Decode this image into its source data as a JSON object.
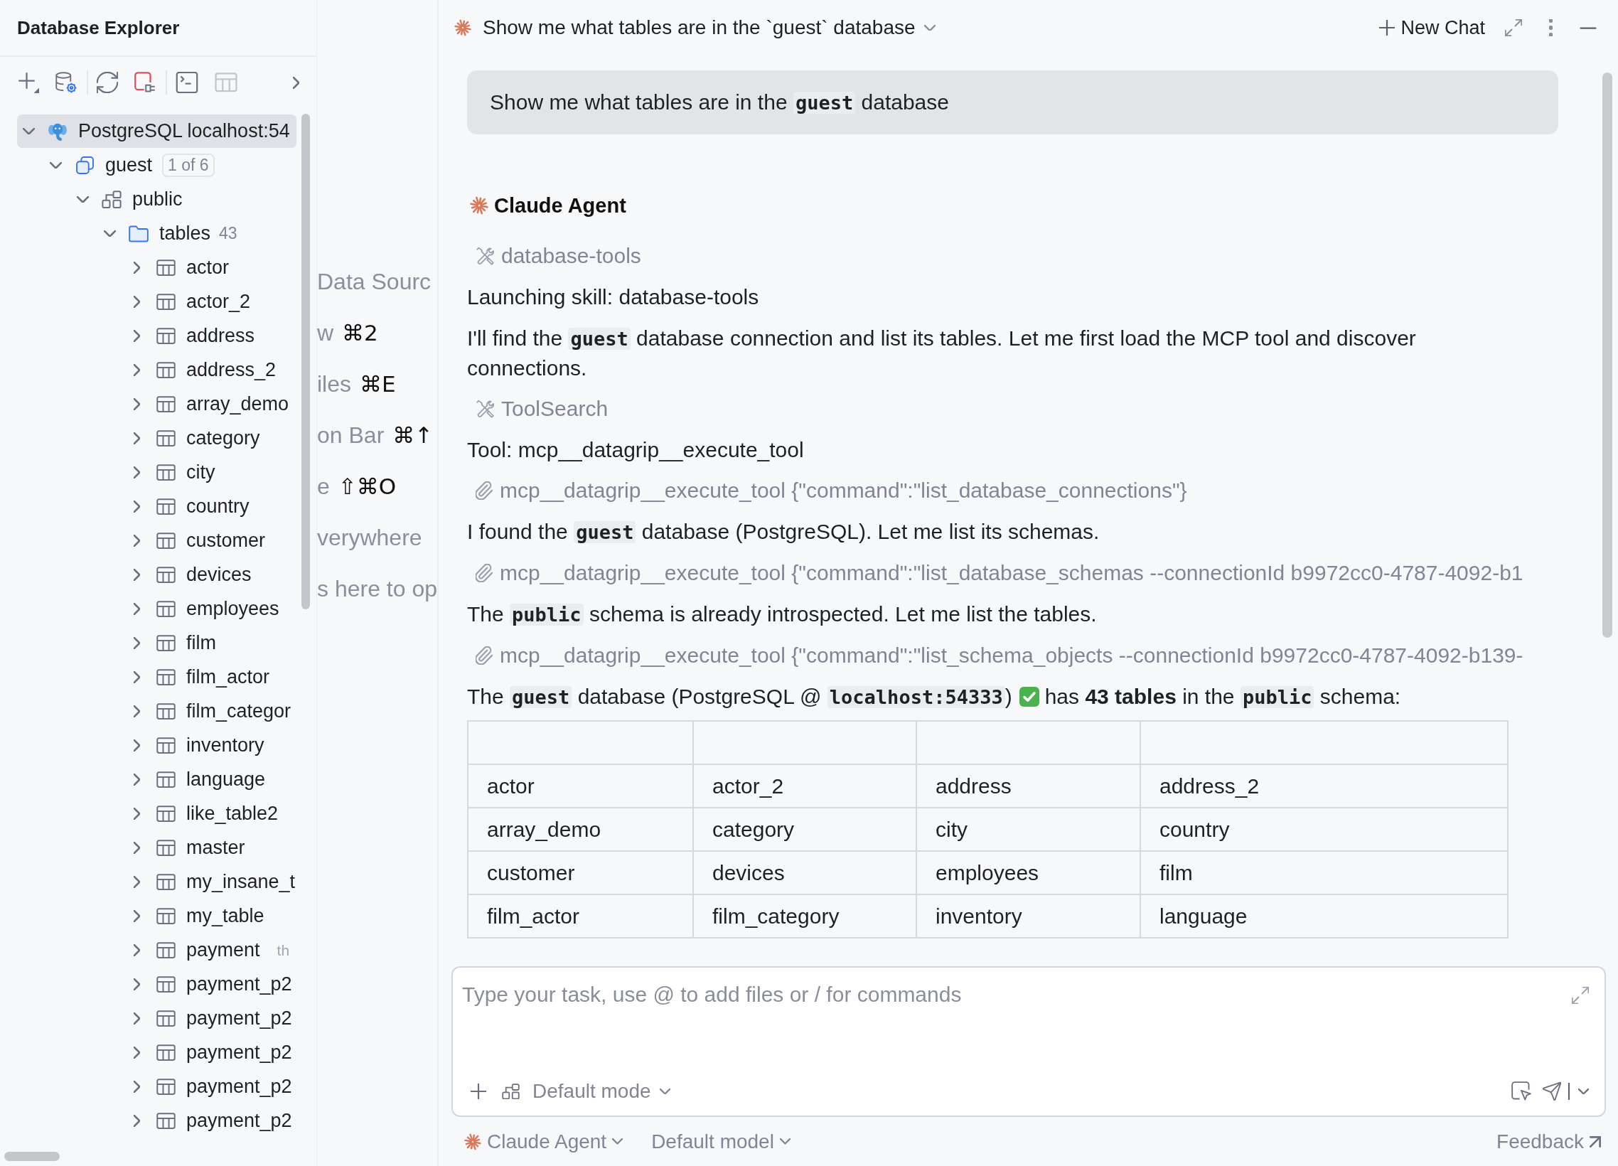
{
  "explorer": {
    "title": "Database Explorer",
    "toolbar": [
      {
        "items": [
          {
            "kind": "add",
            "disabled": false
          },
          {
            "kind": "settings",
            "disabled": false
          }
        ]
      },
      {
        "items": [
          {
            "kind": "refresh",
            "disabled": false
          },
          {
            "kind": "disconnect",
            "disabled": false
          }
        ]
      },
      {
        "items": [
          {
            "kind": "console",
            "disabled": false
          },
          {
            "kind": "table",
            "disabled": true
          }
        ]
      }
    ],
    "tree": [
      {
        "label": "PostgreSQL localhost:54",
        "kind": "datasource",
        "expanded": true,
        "selected": true,
        "children": [
          {
            "label": "guest",
            "kind": "database",
            "badge": "1 of 6",
            "expanded": true,
            "selected": false,
            "children": [
              {
                "label": "public",
                "kind": "schema",
                "expanded": true,
                "selected": false,
                "children": [
                  {
                    "label": "tables",
                    "kind": "folder",
                    "count": "43",
                    "expanded": true,
                    "selected": false,
                    "children": [
                      {
                        "label": "actor",
                        "kind": "table",
                        "expanded": false,
                        "selected": false
                      },
                      {
                        "label": "actor_2",
                        "kind": "table",
                        "expanded": false,
                        "selected": false
                      },
                      {
                        "label": "address",
                        "kind": "table",
                        "expanded": false,
                        "selected": false
                      },
                      {
                        "label": "address_2",
                        "kind": "table",
                        "expanded": false,
                        "selected": false
                      },
                      {
                        "label": "array_demo",
                        "kind": "table",
                        "expanded": false,
                        "selected": false
                      },
                      {
                        "label": "category",
                        "kind": "table",
                        "expanded": false,
                        "selected": false
                      },
                      {
                        "label": "city",
                        "kind": "table",
                        "expanded": false,
                        "selected": false
                      },
                      {
                        "label": "country",
                        "kind": "table",
                        "expanded": false,
                        "selected": false
                      },
                      {
                        "label": "customer",
                        "kind": "table",
                        "expanded": false,
                        "selected": false
                      },
                      {
                        "label": "devices",
                        "kind": "table",
                        "expanded": false,
                        "selected": false
                      },
                      {
                        "label": "employees",
                        "kind": "table",
                        "expanded": false,
                        "selected": false
                      },
                      {
                        "label": "film",
                        "kind": "table",
                        "expanded": false,
                        "selected": false
                      },
                      {
                        "label": "film_actor",
                        "kind": "table",
                        "expanded": false,
                        "selected": false
                      },
                      {
                        "label": "film_categor",
                        "kind": "table",
                        "expanded": false,
                        "selected": false
                      },
                      {
                        "label": "inventory",
                        "kind": "table",
                        "expanded": false,
                        "selected": false
                      },
                      {
                        "label": "language",
                        "kind": "table",
                        "expanded": false,
                        "selected": false
                      },
                      {
                        "label": "like_table2",
                        "kind": "table",
                        "expanded": false,
                        "selected": false
                      },
                      {
                        "label": "master",
                        "kind": "table",
                        "expanded": false,
                        "selected": false
                      },
                      {
                        "label": "my_insane_t",
                        "kind": "table",
                        "expanded": false,
                        "selected": false
                      },
                      {
                        "label": "my_table",
                        "kind": "table",
                        "expanded": false,
                        "selected": false
                      },
                      {
                        "label": "payment",
                        "kind": "table",
                        "comment": "th",
                        "expanded": false,
                        "selected": false
                      },
                      {
                        "label": "payment_p2",
                        "kind": "table",
                        "expanded": false,
                        "selected": false
                      },
                      {
                        "label": "payment_p2",
                        "kind": "table",
                        "expanded": false,
                        "selected": false
                      },
                      {
                        "label": "payment_p2",
                        "kind": "table",
                        "expanded": false,
                        "selected": false
                      },
                      {
                        "label": "payment_p2",
                        "kind": "table",
                        "expanded": false,
                        "selected": false
                      },
                      {
                        "label": "payment_p2",
                        "kind": "table",
                        "expanded": false,
                        "selected": false
                      }
                    ]
                  }
                ]
              }
            ]
          }
        ]
      }
    ]
  },
  "editor_hints": [
    {
      "text": "Data Sourc"
    },
    {
      "text": "w",
      "shortcut": "⌘2"
    },
    {
      "text": "iles",
      "shortcut": "⌘E"
    },
    {
      "text": "on Bar",
      "shortcut": "⌘↑"
    },
    {
      "text": "e",
      "shortcut": "⇧⌘O"
    },
    {
      "text": "verywhere"
    },
    {
      "text": "s here to op"
    }
  ],
  "chat": {
    "title": "Show me what tables are in the `guest` database",
    "new_chat": "New Chat",
    "user_message": [
      {
        "kind": "text",
        "text": "Show me what tables are in the "
      },
      {
        "kind": "code",
        "text": "guest"
      },
      {
        "kind": "text",
        "text": " database"
      }
    ],
    "agent": "Claude Agent",
    "items": [
      {
        "kind": "skill",
        "label": "database-tools"
      },
      {
        "kind": "text",
        "segments": [
          {
            "kind": "text",
            "text": "Launching skill: database-tools"
          }
        ]
      },
      {
        "kind": "text",
        "segments": [
          {
            "kind": "text",
            "text": "I'll find the "
          },
          {
            "kind": "code",
            "text": "guest"
          },
          {
            "kind": "text",
            "text": " database connection and list its tables. Let me first load the MCP tool and discover connections."
          }
        ]
      },
      {
        "kind": "skill",
        "label": "ToolSearch"
      },
      {
        "kind": "text",
        "segments": [
          {
            "kind": "text",
            "text": "Tool: mcp__datagrip__execute_tool"
          }
        ]
      },
      {
        "kind": "call",
        "label": "mcp__datagrip__execute_tool {\"command\":\"list_database_connections\"}"
      },
      {
        "kind": "text",
        "segments": [
          {
            "kind": "text",
            "text": "I found the "
          },
          {
            "kind": "code",
            "text": "guest"
          },
          {
            "kind": "text",
            "text": " database (PostgreSQL). Let me list its schemas."
          }
        ]
      },
      {
        "kind": "call",
        "label": "mcp__datagrip__execute_tool {\"command\":\"list_database_schemas --connectionId b9972cc0-4787-4092-b1"
      },
      {
        "kind": "text",
        "segments": [
          {
            "kind": "text",
            "text": "The "
          },
          {
            "kind": "code",
            "text": "public"
          },
          {
            "kind": "text",
            "text": " schema is already introspected. Let me list the tables."
          }
        ]
      },
      {
        "kind": "call",
        "label": "mcp__datagrip__execute_tool {\"command\":\"list_schema_objects --connectionId b9972cc0-4787-4092-b139-"
      },
      {
        "kind": "text",
        "segments": [
          {
            "kind": "text",
            "text": "The "
          },
          {
            "kind": "code",
            "text": "guest"
          },
          {
            "kind": "text",
            "text": " database (PostgreSQL @ "
          },
          {
            "kind": "code",
            "text": "localhost:54333"
          },
          {
            "kind": "text",
            "text": ")"
          },
          {
            "kind": "check"
          },
          {
            "kind": "text",
            "text": "has **43 tables** in the "
          },
          {
            "kind": "code",
            "text": "public"
          },
          {
            "kind": "text",
            "text": " schema:"
          }
        ]
      },
      {
        "kind": "table",
        "rows": [
          [
            "actor",
            "actor_2",
            "address",
            "address_2"
          ],
          [
            "array_demo",
            "category",
            "city",
            "country"
          ],
          [
            "customer",
            "devices",
            "employees",
            "film"
          ],
          [
            "film_actor",
            "film_category",
            "inventory",
            "language"
          ]
        ]
      }
    ]
  },
  "composer": {
    "placeholder": "Type your task, use @ to add files or / for commands",
    "mode": "Default mode"
  },
  "footer": {
    "agent": "Claude Agent",
    "model": "Default model",
    "feedback": "Feedback"
  }
}
